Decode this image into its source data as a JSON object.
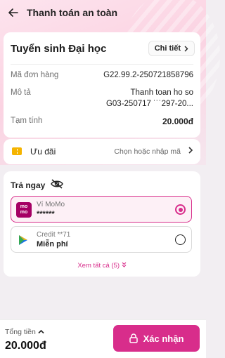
{
  "header": {
    "title": "Thanh toán an toàn",
    "back_icon": "back-arrow-icon"
  },
  "order": {
    "title": "Tuyển sinh Đại học",
    "detail_label": "Chi tiết",
    "order_id_label": "Mã đơn hàng",
    "order_id_value": "G22.99.2-250721858796",
    "desc_label": "Mô tả",
    "desc_line1": "Thanh toan ho so",
    "desc_line2": "G03-250717 ˙˙˙297-20...",
    "subtotal_label": "Tạm tính",
    "subtotal_value": "20.000đ"
  },
  "promo": {
    "icon": "voucher-icon",
    "label": "Ưu đãi",
    "hint": "Chọn hoặc nhập mã"
  },
  "payment": {
    "title": "Trả ngay",
    "eye_icon": "eye-off-icon",
    "methods": [
      {
        "logo_text": "mo mo",
        "name": "Ví MoMo",
        "sub": "******",
        "selected": true
      },
      {
        "logo": "play-icon",
        "name": "Credit **71",
        "sub": "Miễn phí",
        "selected": false
      }
    ],
    "see_all": "Xem tất cả (5)"
  },
  "footer": {
    "total_label": "Tổng tiền",
    "total_value": "20.000đ",
    "confirm_label": "Xác nhận",
    "lock_icon": "lock-icon"
  },
  "colors": {
    "accent": "#d82d8b",
    "momo": "#a50064",
    "voucher": "#f5b400"
  }
}
